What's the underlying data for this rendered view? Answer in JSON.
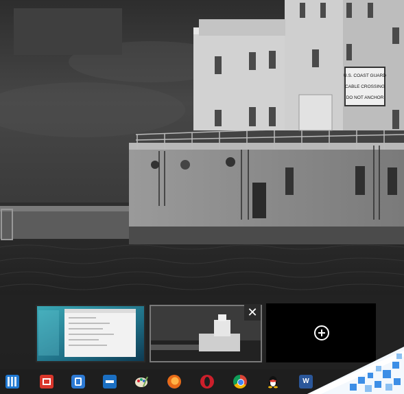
{
  "taskbar": {
    "items": [
      {
        "name": "task-view",
        "icon": "task-view-icon"
      },
      {
        "name": "app-1",
        "icon": "red-app-icon"
      },
      {
        "name": "app-2",
        "icon": "blue-document-icon"
      },
      {
        "name": "app-3",
        "icon": "arrow-app-icon"
      },
      {
        "name": "app-4",
        "icon": "paint-icon"
      },
      {
        "name": "firefox",
        "icon": "firefox-icon"
      },
      {
        "name": "opera",
        "icon": "opera-icon"
      },
      {
        "name": "chrome",
        "icon": "chrome-icon"
      },
      {
        "name": "qq",
        "icon": "qq-penguin-icon"
      },
      {
        "name": "word",
        "icon": "word-icon",
        "label": "W"
      }
    ]
  },
  "task_view": {
    "close_label": "✕",
    "desktops": [
      {
        "id": "desktop-1",
        "active": false
      },
      {
        "id": "desktop-2",
        "active": true
      }
    ],
    "new_desktop_icon": "plus-circle-icon"
  },
  "wallpaper": {
    "sign": {
      "line1": "U.S. COAST GUARD",
      "line2": "CABLE CROSSING",
      "line3": "DO NOT ANCHOR"
    }
  },
  "colors": {
    "taskbar_bg": "#1e1e1e",
    "task_view_bg": "#232323",
    "accent_blue": "#1f78d1"
  }
}
